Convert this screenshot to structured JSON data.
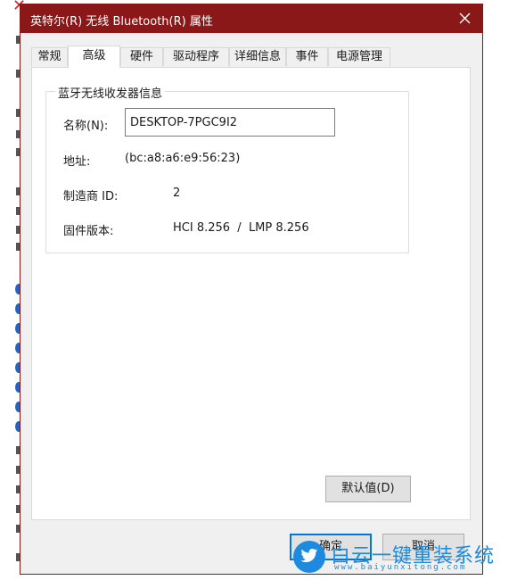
{
  "dialog": {
    "title": "英特尔(R) 无线 Bluetooth(R) 属性",
    "close_glyph": "close-icon"
  },
  "tabs": [
    {
      "label": "常规"
    },
    {
      "label": "高级",
      "active": true
    },
    {
      "label": "硬件"
    },
    {
      "label": "驱动程序"
    },
    {
      "label": "详细信息"
    },
    {
      "label": "事件"
    },
    {
      "label": "电源管理"
    }
  ],
  "radio_info": {
    "group_title": "蓝牙无线收发器信息",
    "name_label": "名称(N):",
    "name_value": "DESKTOP-7PGC9I2",
    "address_label": "地址:",
    "address_value": "(bc:a8:a6:e9:56:23)",
    "manufacturer_label": "制造商 ID:",
    "manufacturer_value": "2",
    "firmware_label": "固件版本:",
    "firmware_value": "HCI 8.256  /  LMP 8.256"
  },
  "buttons": {
    "default_label": "默认值(D)",
    "ok_label": "确定",
    "cancel_label": "取消"
  },
  "watermark": {
    "brand": "白云一键重装系统",
    "url": "www.baiyunxitong.com",
    "icon": "twitter-bird-icon"
  },
  "colors": {
    "titlebar": "#8b1818",
    "accent": "#0078d7",
    "watermark": "#1d8ae0"
  }
}
